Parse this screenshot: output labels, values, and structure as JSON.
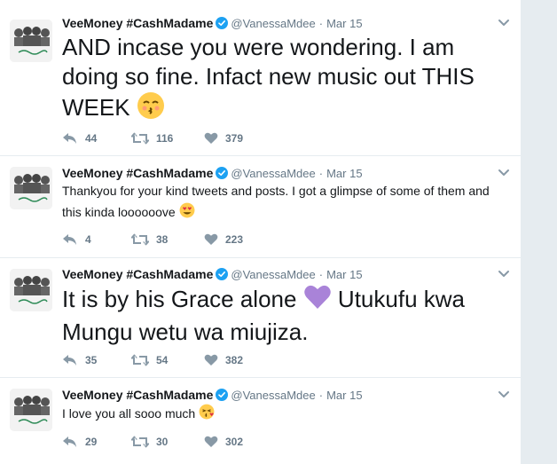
{
  "colors": {
    "accent": "#1da1f2",
    "text_primary": "#14171a",
    "text_secondary": "#657786",
    "divider": "#e6ecf0",
    "verified": "#1da1f2",
    "heart_purple": "#a983d8",
    "emoji_yellow": "#ffcc4d"
  },
  "tweets": [
    {
      "author_name": "VeeMoney #CashMadame",
      "handle": "@VanessaMdee",
      "separator": "·",
      "time": "Mar 15",
      "text": "AND incase you were wondering. I am doing so fine. Infact new music out THIS WEEK",
      "emoji": "kissing-face-with-smiling-eyes",
      "replies": "44",
      "retweets": "116",
      "likes": "379"
    },
    {
      "author_name": "VeeMoney #CashMadame",
      "handle": "@VanessaMdee",
      "separator": "·",
      "time": "Mar 15",
      "text": "Thankyou for your kind tweets and posts. I got a glimpse of some of them and this kinda loooooove",
      "emoji": "smiling-face-with-heart-eyes",
      "replies": "4",
      "retweets": "38",
      "likes": "223"
    },
    {
      "author_name": "VeeMoney #CashMadame",
      "handle": "@VanessaMdee",
      "separator": "·",
      "time": "Mar 15",
      "text_part1": "It is by his Grace alone",
      "text_part2": " Utukufu kwa Mungu wetu wa miujiza.",
      "emoji": "purple-heart",
      "replies": "35",
      "retweets": "54",
      "likes": "382"
    },
    {
      "author_name": "VeeMoney #CashMadame",
      "handle": "@VanessaMdee",
      "separator": "·",
      "time": "Mar 15",
      "text": "I love you all sooo much",
      "emoji": "face-blowing-a-kiss",
      "replies": "29",
      "retweets": "30",
      "likes": "302"
    }
  ]
}
